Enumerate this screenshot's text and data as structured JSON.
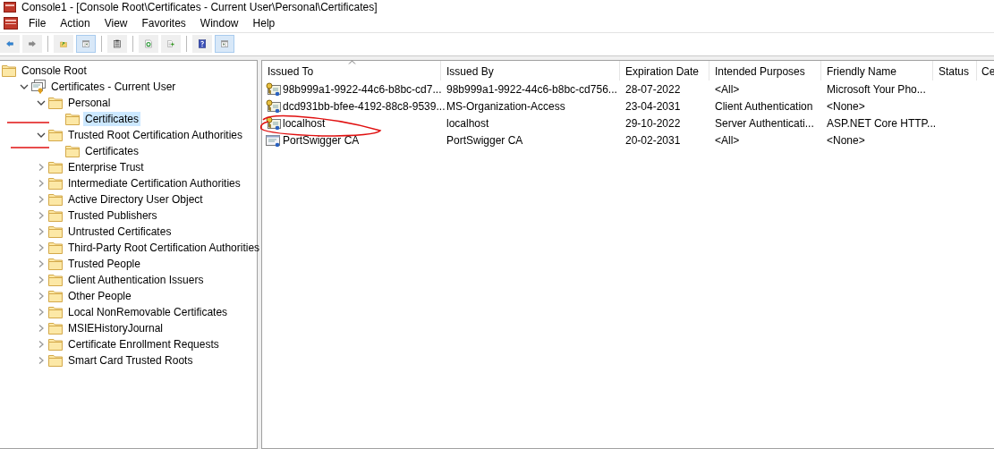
{
  "window": {
    "title": "Console1 - [Console Root\\Certificates - Current User\\Personal\\Certificates]"
  },
  "menu": [
    "File",
    "Action",
    "View",
    "Favorites",
    "Window",
    "Help"
  ],
  "toolbar": [
    {
      "kind": "back",
      "pressed": false
    },
    {
      "kind": "forward",
      "pressed": false
    },
    {
      "kind": "sep"
    },
    {
      "kind": "up",
      "pressed": false
    },
    {
      "kind": "tree",
      "pressed": true
    },
    {
      "kind": "sep"
    },
    {
      "kind": "clipboard",
      "pressed": false
    },
    {
      "kind": "sep"
    },
    {
      "kind": "refresh",
      "pressed": false
    },
    {
      "kind": "export",
      "pressed": false
    },
    {
      "kind": "sep"
    },
    {
      "kind": "help",
      "pressed": false
    },
    {
      "kind": "pane",
      "pressed": true
    }
  ],
  "tree": [
    {
      "label": "Console Root",
      "kind": "folder",
      "selected": false,
      "children": [
        {
          "label": "Certificates - Current User",
          "kind": "store",
          "selected": false,
          "expanded": true,
          "children": [
            {
              "label": "Personal",
              "kind": "folder",
              "selected": false,
              "expanded": true,
              "children": [
                {
                  "label": "Certificates",
                  "kind": "folder",
                  "selected": true
                }
              ]
            },
            {
              "label": "Trusted Root Certification Authorities",
              "kind": "folder",
              "selected": false,
              "expanded": true,
              "children": [
                {
                  "label": "Certificates",
                  "kind": "folder",
                  "selected": false
                }
              ]
            },
            {
              "label": "Enterprise Trust",
              "kind": "folder",
              "selected": false,
              "expanded": false
            },
            {
              "label": "Intermediate Certification Authorities",
              "kind": "folder",
              "selected": false,
              "expanded": false
            },
            {
              "label": "Active Directory User Object",
              "kind": "folder",
              "selected": false,
              "expanded": false
            },
            {
              "label": "Trusted Publishers",
              "kind": "folder",
              "selected": false,
              "expanded": false
            },
            {
              "label": "Untrusted Certificates",
              "kind": "folder",
              "selected": false,
              "expanded": false
            },
            {
              "label": "Third-Party Root Certification Authorities",
              "kind": "folder",
              "selected": false,
              "expanded": false
            },
            {
              "label": "Trusted People",
              "kind": "folder",
              "selected": false,
              "expanded": false
            },
            {
              "label": "Client Authentication Issuers",
              "kind": "folder",
              "selected": false,
              "expanded": false
            },
            {
              "label": "Other People",
              "kind": "folder",
              "selected": false,
              "expanded": false
            },
            {
              "label": "Local NonRemovable Certificates",
              "kind": "folder",
              "selected": false,
              "expanded": false
            },
            {
              "label": "MSIEHistoryJournal",
              "kind": "folder",
              "selected": false,
              "expanded": false
            },
            {
              "label": "Certificate Enrollment Requests",
              "kind": "folder",
              "selected": false,
              "expanded": false
            },
            {
              "label": "Smart Card Trusted Roots",
              "kind": "folder",
              "selected": false,
              "expanded": false
            }
          ]
        }
      ]
    }
  ],
  "table": {
    "columns": [
      {
        "label": "Issued To",
        "sorted": true
      },
      {
        "label": "Issued By",
        "sorted": false
      },
      {
        "label": "Expiration Date",
        "sorted": false
      },
      {
        "label": "Intended Purposes",
        "sorted": false
      },
      {
        "label": "Friendly Name",
        "sorted": false
      },
      {
        "label": "Status",
        "sorted": false
      },
      {
        "label": "Ce",
        "sorted": false
      }
    ],
    "rows": [
      {
        "private_key": true,
        "cells": [
          "98b999a1-9922-44c6-b8bc-cd7...",
          "98b999a1-9922-44c6-b8bc-cd756...",
          "28-07-2022",
          "<All>",
          "Microsoft Your Pho..."
        ]
      },
      {
        "private_key": true,
        "cells": [
          "dcd931bb-bfee-4192-88c8-9539...",
          "MS-Organization-Access",
          "23-04-2031",
          "Client Authentication",
          "<None>"
        ]
      },
      {
        "private_key": true,
        "cells": [
          "localhost",
          "localhost",
          "29-10-2022",
          "Server Authenticati...",
          "ASP.NET Core HTTP..."
        ]
      },
      {
        "private_key": false,
        "cells": [
          "PortSwigger CA",
          "PortSwigger CA",
          "20-02-2031",
          "<All>",
          "<None>"
        ]
      }
    ]
  }
}
